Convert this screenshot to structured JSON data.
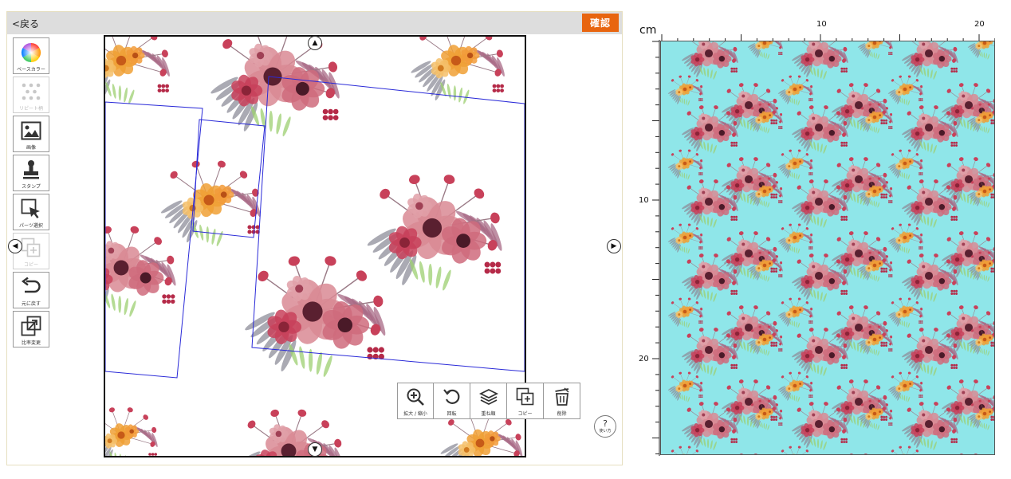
{
  "header": {
    "back_label": "<戻る",
    "confirm_label": "確認"
  },
  "toolbar": {
    "items": [
      {
        "name": "base-color",
        "label": "ベースカラー",
        "icon": "color-wheel-icon",
        "disabled": false
      },
      {
        "name": "repeat",
        "label": "リピート柄",
        "icon": "dots-grid-icon",
        "disabled": true
      },
      {
        "name": "image",
        "label": "画像",
        "icon": "image-icon",
        "disabled": false
      },
      {
        "name": "stamp",
        "label": "スタンプ",
        "icon": "stamp-icon",
        "disabled": false
      },
      {
        "name": "parts-select",
        "label": "パーツ選択",
        "icon": "select-cursor-icon",
        "disabled": false
      },
      {
        "name": "copy",
        "label": "コピー",
        "icon": "copy-icon",
        "disabled": true
      },
      {
        "name": "undo",
        "label": "元に戻す",
        "icon": "undo-icon",
        "disabled": false
      },
      {
        "name": "ratio",
        "label": "比率変更",
        "icon": "resize-icon",
        "disabled": false
      }
    ]
  },
  "float_tools": {
    "items": [
      {
        "name": "zoom",
        "label": "拡大 / 縮小",
        "icon": "zoom-in-icon"
      },
      {
        "name": "rotate",
        "label": "回転",
        "icon": "rotate-icon"
      },
      {
        "name": "layer-order",
        "label": "重ね順",
        "icon": "layers-icon"
      },
      {
        "name": "copy",
        "label": "コピー",
        "icon": "copy-icon"
      },
      {
        "name": "delete",
        "label": "削除",
        "icon": "trash-icon"
      }
    ]
  },
  "help": {
    "symbol": "?",
    "label": "使い方"
  },
  "preview": {
    "unit": "cm",
    "top_ruler_labels": [
      "10",
      "20"
    ],
    "left_ruler_labels": [
      "10",
      "20"
    ],
    "background_color": "#8fe6e9"
  },
  "colors": {
    "accent": "#e8650f",
    "selection": "#2a2ad8",
    "flower_red": "#c8415a",
    "flower_pink": "#d98a94",
    "flower_orange": "#f0a035",
    "foliage": "#8d8d9a"
  }
}
